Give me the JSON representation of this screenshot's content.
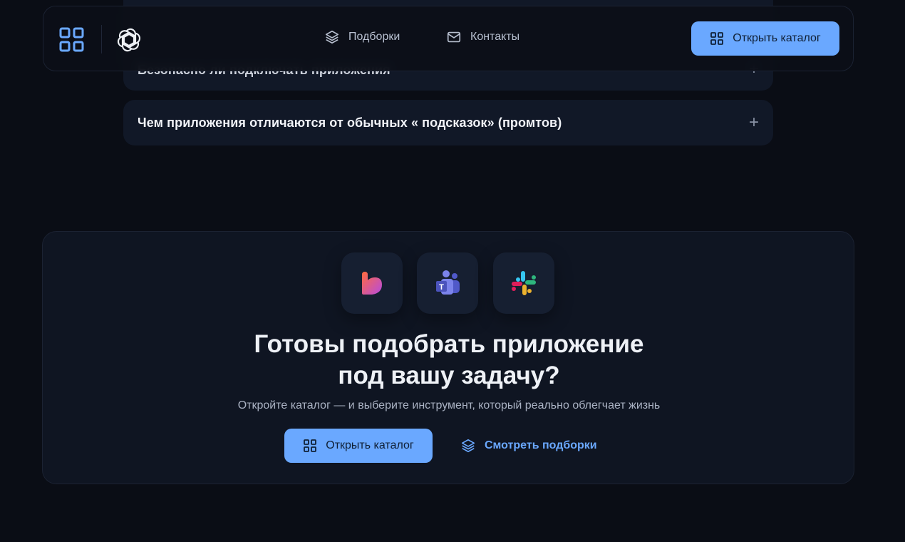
{
  "faq": {
    "items": [
      {
        "question": "Безопасно ли подключать приложения",
        "toggle": "+"
      },
      {
        "question": "Чем приложения отличаются от обычных « подсказок» (промтов)",
        "toggle": "+"
      }
    ]
  },
  "header": {
    "logo_icon": "grid-logo-icon",
    "brand_icon": "openai-logo-icon",
    "nav": [
      {
        "label": "Подборки",
        "icon": "layers-icon"
      },
      {
        "label": "Контакты",
        "icon": "mail-icon"
      }
    ],
    "cta_label": "Открыть каталог",
    "cta_icon": "grid-icon"
  },
  "cta_section": {
    "apps": [
      {
        "icon": "heart-app-icon"
      },
      {
        "icon": "microsoft-teams-icon"
      },
      {
        "icon": "slack-icon"
      }
    ],
    "title_line1": "Готовы подобрать приложение",
    "title_line2": "под вашу задачу?",
    "subtitle": "Откройте каталог — и выберите инструмент, который реально облегчает жизнь",
    "primary_label": "Открыть каталог",
    "secondary_label": "Смотреть подборки"
  },
  "colors": {
    "background": "#0a0d15",
    "card": "#111827",
    "accent": "#6aa8ff"
  }
}
